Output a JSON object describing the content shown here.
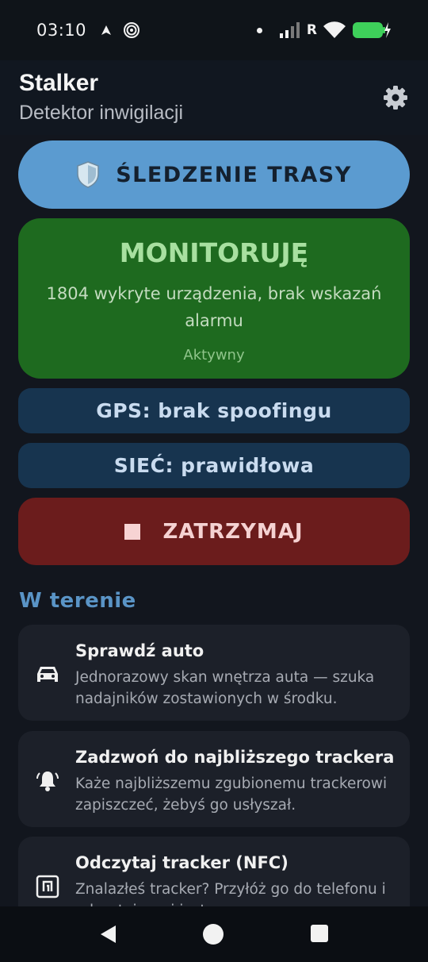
{
  "status_bar": {
    "time": "03:10",
    "network_label": "R"
  },
  "header": {
    "title": "Stalker",
    "subtitle": "Detektor inwigilacji"
  },
  "route_button": {
    "label": "ŚLEDZENIE TRASY"
  },
  "monitor": {
    "title": "MONITORUJĘ",
    "description": "1804 wykryte urządzenia, brak wskazań alarmu",
    "status": "Aktywny",
    "background_color": "#1e6a1f"
  },
  "gps": {
    "label": "GPS: brak spoofingu"
  },
  "network": {
    "label": "SIEĆ: prawidłowa"
  },
  "stop_button": {
    "label": "ZATRZYMAJ",
    "background_color": "#6b1c1c"
  },
  "field_section": {
    "title": "W terenie",
    "items": [
      {
        "icon": "car-icon",
        "title": "Sprawdź auto",
        "description": "Jednorazowy skan wnętrza auta — szuka nadajników zostawionych w środku."
      },
      {
        "icon": "bell-ring-icon",
        "title": "Zadzwoń do najbliższego trackera",
        "description": "Każe najbliższemu zgubionemu trackerowi zapiszczeć, żebyś go usłyszał."
      },
      {
        "icon": "nfc-icon",
        "title": "Odczytaj tracker (NFC)",
        "description": "Znalazłeś tracker? Przyłóż go do telefonu i odczytaj, czyj jest."
      }
    ]
  },
  "colors": {
    "accent": "#5b9bd0",
    "section_title": "#5a94c6",
    "background": "#12161e"
  }
}
